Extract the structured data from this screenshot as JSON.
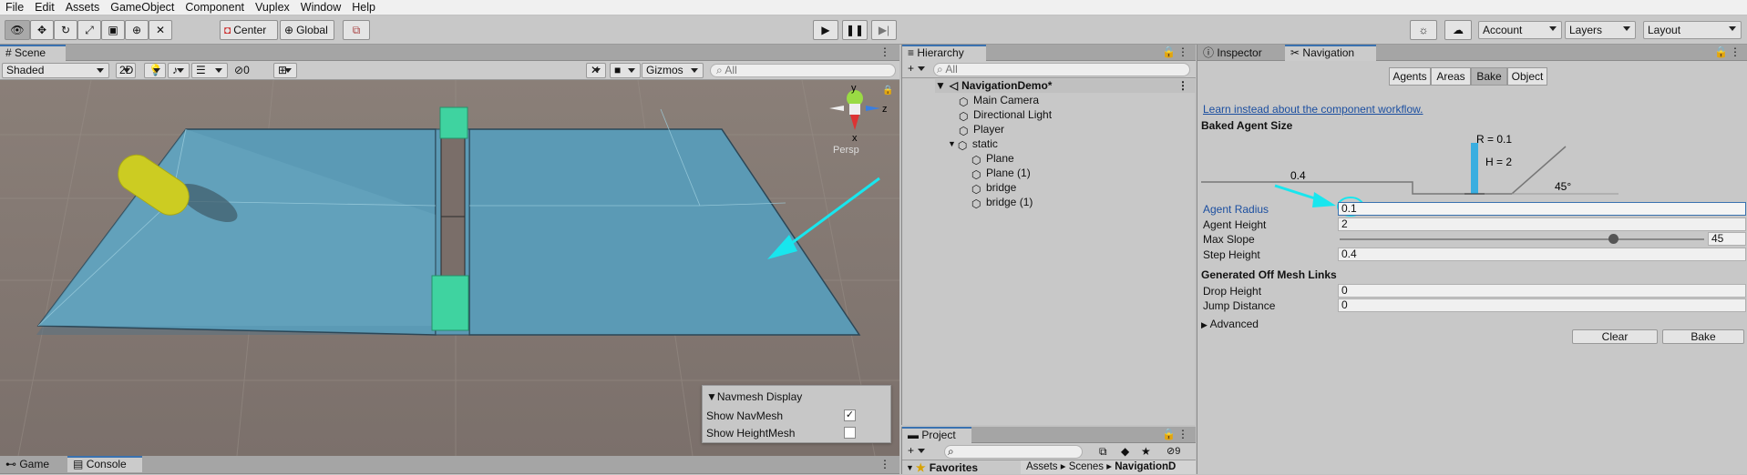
{
  "menu": [
    "File",
    "Edit",
    "Assets",
    "GameObject",
    "Component",
    "Vuplex",
    "Window",
    "Help"
  ],
  "toolbar": {
    "center_label": "Center",
    "global_label": "Global",
    "account_label": "Account",
    "layers_label": "Layers",
    "layout_label": "Layout"
  },
  "scene": {
    "tab_label": "Scene",
    "shading_mode": "Shaded",
    "mode_2d": "2D",
    "hidden_count": "0",
    "gizmos_label": "Gizmos",
    "search_placeholder": "All",
    "gizmo_y": "y",
    "gizmo_x": "x",
    "gizmo_z": "z",
    "persp_label": "Persp",
    "navmesh_display": {
      "title": "Navmesh Display",
      "show_navmesh_label": "Show NavMesh",
      "show_navmesh_checked": true,
      "show_heightmesh_label": "Show HeightMesh",
      "show_heightmesh_checked": false
    }
  },
  "bottom_tabs": {
    "game_label": "Game",
    "console_label": "Console"
  },
  "hierarchy": {
    "tab_label": "Hierarchy",
    "search_placeholder": "All",
    "scene_name": "NavigationDemo*",
    "items": [
      "Main Camera",
      "Directional Light",
      "Player",
      "static",
      "Plane",
      "Plane (1)",
      "bridge",
      "bridge (1)"
    ]
  },
  "project": {
    "tab_label": "Project",
    "hidden_count": "9",
    "favorites_label": "Favorites",
    "breadcrumb": [
      "Assets",
      "Scenes",
      "NavigationD"
    ]
  },
  "inspector": {
    "tab_label": "Inspector",
    "navigation_tab_label": "Navigation",
    "subtabs": [
      "Agents",
      "Areas",
      "Bake",
      "Object"
    ],
    "active_subtab": "Bake",
    "workflow_link": "Learn instead about the component workflow.",
    "baked_agent_size_header": "Baked Agent Size",
    "diagram": {
      "radius_label": "R = 0.1",
      "height_label": "H = 2",
      "step_label": "0.4",
      "slope_label": "45°"
    },
    "fields": {
      "agent_radius_label": "Agent Radius",
      "agent_radius_value": "0.1",
      "agent_height_label": "Agent Height",
      "agent_height_value": "2",
      "max_slope_label": "Max Slope",
      "max_slope_value": "45",
      "max_slope_fraction": 0.75,
      "step_height_label": "Step Height",
      "step_height_value": "0.4"
    },
    "offmesh_header": "Generated Off Mesh Links",
    "drop_height_label": "Drop Height",
    "drop_height_value": "0",
    "jump_distance_label": "Jump Distance",
    "jump_distance_value": "0",
    "advanced_label": "Advanced",
    "clear_label": "Clear",
    "bake_label": "Bake"
  },
  "colors": {
    "navmesh": "#5b9ab5",
    "bridge_green": "#3fd3a0",
    "annotation_cyan": "#18e6ee",
    "selection_blue": "#3a72b0"
  }
}
